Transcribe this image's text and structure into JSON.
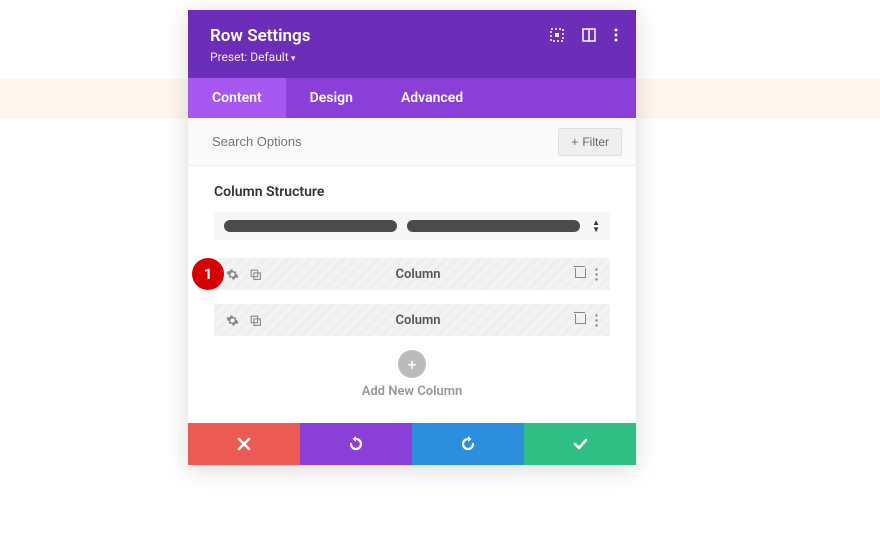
{
  "annotation": {
    "badge": "1"
  },
  "header": {
    "title": "Row Settings",
    "preset_label": "Preset: Default"
  },
  "tabs": {
    "content": "Content",
    "design": "Design",
    "advanced": "Advanced"
  },
  "search": {
    "placeholder": "Search Options",
    "filter_label": "Filter"
  },
  "section": {
    "column_structure": "Column Structure",
    "column_label_1": "Column",
    "column_label_2": "Column",
    "add_new": "Add New Column"
  },
  "colors": {
    "header": "#6c2eb9",
    "tabs": "#8b3fd9",
    "active_tab": "#a557f0",
    "cancel": "#eb5b53",
    "undo": "#8b3fd9",
    "redo": "#2c8fdd",
    "save": "#2fbf85",
    "badge": "#d60000"
  }
}
